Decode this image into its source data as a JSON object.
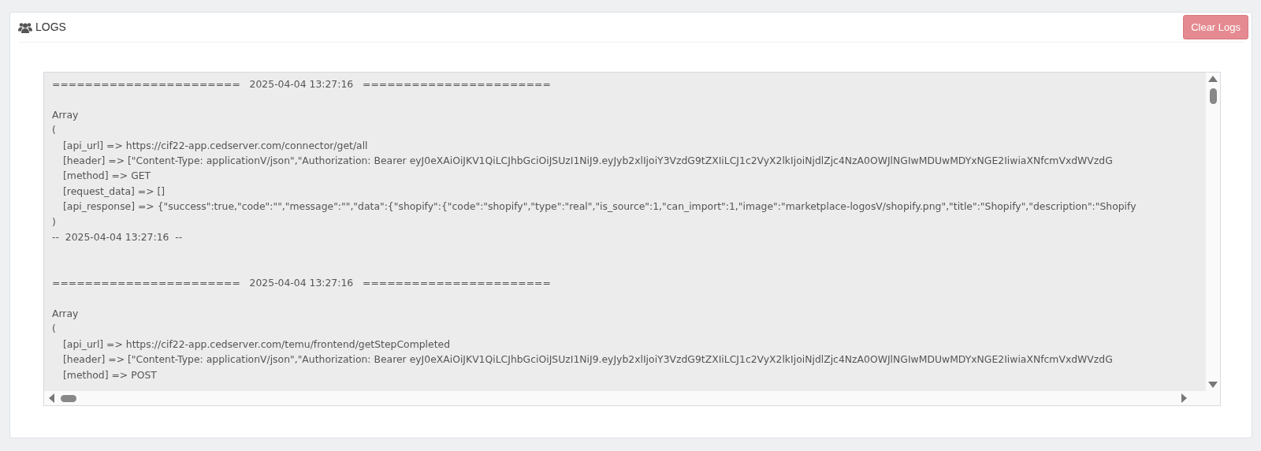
{
  "panel": {
    "title": "LOGS",
    "clear_button": "Clear Logs"
  },
  "log_entries": [
    {
      "separator_left": "=======================",
      "timestamp": "2025-04-04 13:27:16",
      "separator_right": "=======================",
      "lines": [
        {
          "kind": "plain",
          "text": "Array"
        },
        {
          "kind": "plain",
          "text": "("
        },
        {
          "kind": "field",
          "text": "[api_url] => https://cif22-app.cedserver.com/connector/get/all"
        },
        {
          "kind": "field",
          "text": "[header] => [\"Content-Type: applicationV/json\",\"Authorization: Bearer eyJ0eXAiOiJKV1QiLCJhbGciOiJSUzI1NiJ9.eyJyb2xlIjoiY3VzdG9tZXIiLCJ1c2VyX2lkIjoiNjdlZjc4NzA0OWJlNGIwMDUwMDYxNGE2IiwiaXNfcmVxdWVzdG"
        },
        {
          "kind": "field",
          "text": "[method] => GET"
        },
        {
          "kind": "field",
          "text": "[request_data] => []"
        },
        {
          "kind": "field",
          "text": "[api_response] => {\"success\":true,\"code\":\"\",\"message\":\"\",\"data\":{\"shopify\":{\"code\":\"shopify\",\"type\":\"real\",\"is_source\":1,\"can_import\":1,\"image\":\"marketplace-logosV/shopify.png\",\"title\":\"Shopify\",\"description\":\"Shopify"
        },
        {
          "kind": "plain",
          "text": ")"
        }
      ],
      "footer": "--  2025-04-04 13:27:16  --"
    },
    {
      "separator_left": "=======================",
      "timestamp": "2025-04-04 13:27:16",
      "separator_right": "=======================",
      "lines": [
        {
          "kind": "plain",
          "text": "Array"
        },
        {
          "kind": "plain",
          "text": "("
        },
        {
          "kind": "field",
          "text": "[api_url] => https://cif22-app.cedserver.com/temu/frontend/getStepCompleted"
        },
        {
          "kind": "field",
          "text": "[header] => [\"Content-Type: applicationV/json\",\"Authorization: Bearer eyJ0eXAiOiJKV1QiLCJhbGciOiJSUzI1NiJ9.eyJyb2xlIjoiY3VzdG9tZXIiLCJ1c2VyX2lkIjoiNjdlZjc4NzA0OWJlNGIwMDUwMDYxNGE2IiwiaXNfcmVxdWVzdG"
        },
        {
          "kind": "field",
          "text": "[method] => POST"
        }
      ]
    }
  ]
}
